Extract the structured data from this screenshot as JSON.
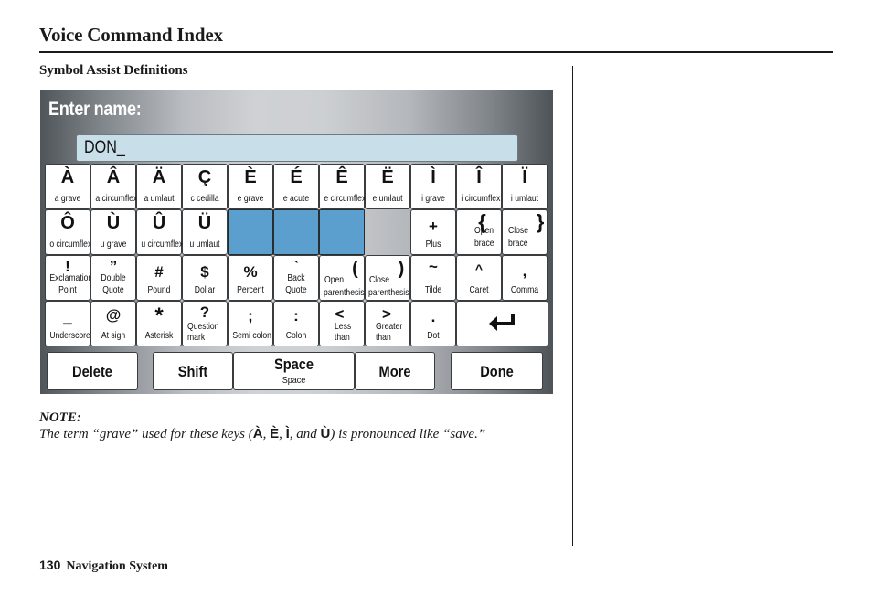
{
  "header": {
    "title": "Voice Command Index",
    "section_title": "Symbol Assist Definitions"
  },
  "screen": {
    "title": "Enter name:",
    "input_value": "DON_",
    "rows": [
      [
        {
          "glyph": "À",
          "label": "a grave"
        },
        {
          "glyph": "Â",
          "label": "a circumflex"
        },
        {
          "glyph": "Ä",
          "label": "a umlaut"
        },
        {
          "glyph": "Ç",
          "label": "c cedilla"
        },
        {
          "glyph": "È",
          "label": "e grave"
        },
        {
          "glyph": "É",
          "label": "e acute"
        },
        {
          "glyph": "Ê",
          "label": "e circumflex"
        },
        {
          "glyph": "Ë",
          "label": "e umlaut"
        },
        {
          "glyph": "Ì",
          "label": "i grave"
        },
        {
          "glyph": "Î",
          "label": "i circumflex"
        },
        {
          "glyph": "Ï",
          "label": "i umlaut"
        }
      ],
      [
        {
          "glyph": "Ô",
          "label": "o circumflex"
        },
        {
          "glyph": "Ù",
          "label": "u grave"
        },
        {
          "glyph": "Û",
          "label": "u circumflex"
        },
        {
          "glyph": "Ü",
          "label": "u umlaut"
        },
        {
          "glyph": "",
          "label": ""
        },
        {
          "glyph": "",
          "label": ""
        },
        {
          "glyph": "",
          "label": ""
        },
        {
          "glyph": "+",
          "label": "Plus"
        },
        {
          "glyph": "{",
          "label_1": "Open",
          "label_2": "brace"
        },
        {
          "glyph": "}",
          "label_1": "Close",
          "label_2": "brace"
        }
      ],
      [
        {
          "glyph": "!",
          "label_1": "Exclamation",
          "label_2": "Point"
        },
        {
          "glyph": "”",
          "label_1": "Double",
          "label_2": "Quote"
        },
        {
          "glyph": "#",
          "label": "Pound"
        },
        {
          "glyph": "$",
          "label": "Dollar"
        },
        {
          "glyph": "%",
          "label": "Percent"
        },
        {
          "glyph": "`",
          "label_1": "Back",
          "label_2": "Quote"
        },
        {
          "glyph": "(",
          "label_1": "Open",
          "label_2": "parenthesis"
        },
        {
          "glyph": ")",
          "label_1": "Close",
          "label_2": "parenthesis"
        },
        {
          "glyph": "~",
          "label": "Tilde"
        },
        {
          "glyph": "^",
          "label": "Caret"
        },
        {
          "glyph": ",",
          "label": "Comma"
        }
      ],
      [
        {
          "glyph": "_",
          "label": "Underscore"
        },
        {
          "glyph": "@",
          "label": "At sign"
        },
        {
          "glyph": "*",
          "label": "Asterisk"
        },
        {
          "glyph": "?",
          "label_1": "Question",
          "label_2": "mark"
        },
        {
          "glyph": ";",
          "label": "Semi colon"
        },
        {
          "glyph": ":",
          "label": "Colon"
        },
        {
          "glyph": "<",
          "label_1": "Less",
          "label_2": "than"
        },
        {
          "glyph": ">",
          "label_1": "Greater",
          "label_2": "than"
        },
        {
          "glyph": ".",
          "label": "Dot"
        },
        {
          "glyph": "enter-icon",
          "label": ""
        }
      ]
    ],
    "buttons": {
      "delete": "Delete",
      "shift": "Shift",
      "space": "Space",
      "space_sub": "Space",
      "more": "More",
      "done": "Done"
    },
    "colors": {
      "blank_key": "#5b9fcf",
      "input_bg": "#c8dfe9"
    }
  },
  "note": {
    "label": "NOTE:",
    "text_before": "The term “grave” used for these keys (",
    "sym_1": "À",
    "sep_1": ", ",
    "sym_2": "È",
    "sep_2": ", ",
    "sym_3": "Ì",
    "sep_3": ", and ",
    "sym_4": "Ù",
    "text_after": ") is pronounced like “save.”"
  },
  "footer": {
    "page_number": "130",
    "section": "Navigation System"
  }
}
